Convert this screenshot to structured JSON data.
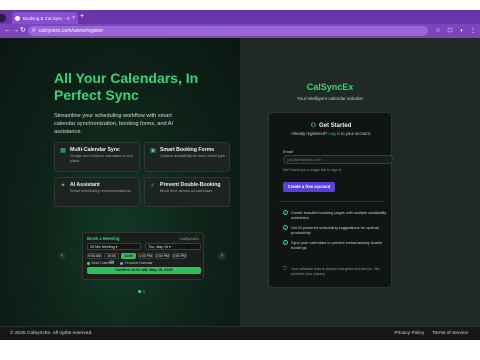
{
  "browser": {
    "tab_title": "Booking & Cal Sync - CalSyncEx",
    "tab_close": "×",
    "new_tab": "+",
    "url": "calsyncex.com/users/register",
    "back": "←",
    "forward": "→",
    "reload": "↻",
    "star": "☆",
    "extension": "⬡",
    "profile": "◐",
    "menu": "⋮"
  },
  "hero": {
    "title": "All Your Calendars, In Perfect Sync",
    "subtitle": "Streamline your scheduling workflow with smart calendar synchronization, booking forms, and AI assistance."
  },
  "features": [
    {
      "icon": "calendar-icon",
      "glyph": "▦",
      "title": "Multi-Calendar Sync",
      "desc": "Google and Outlook calendars in one place."
    },
    {
      "icon": "form-icon",
      "glyph": "▣",
      "title": "Smart Booking Forms",
      "desc": "Custom availability for each event type."
    },
    {
      "icon": "sparkle-icon",
      "glyph": "✦",
      "title": "AI Assistant",
      "desc": "Smart scheduling recommendations."
    },
    {
      "icon": "shield-check-icon",
      "glyph": "✓",
      "title": "Prevent Double-Booking",
      "desc": "Block time across all calendars."
    }
  ],
  "carousel": {
    "prev": "‹",
    "next": "›",
    "booking": {
      "title": "Book a Meeting",
      "brand": "CalSyncEx",
      "meeting_select": "30 Min Meeting",
      "date_select": "Thu, May 15",
      "slots": [
        "9:00 AM",
        "10:00 AM",
        "11:00 AM",
        "1:00 PM",
        "2:00 PM",
        "3:00 PM"
      ],
      "active_slot": "11:00 AM",
      "legend": [
        {
          "label": "Work Calendar",
          "color": "#37d47a"
        },
        {
          "label": "Personal Calendar",
          "color": "#8a93ff"
        }
      ],
      "confirm": "Confirm 11:00 AM, May 15, 2025"
    },
    "dot_count": 2,
    "active_dot": 0
  },
  "signup": {
    "brand": "CalSyncEx",
    "tagline": "Your intelligent calendar solution",
    "heading": "Get Started",
    "already": "Already registered?",
    "login_link": "Log in",
    "to_account": "to your account.",
    "email_label": "Email",
    "email_placeholder": "you@example.com",
    "email_hint": "We'll send you a magic link to sign in",
    "cta": "Create a free account",
    "benefits": [
      "Create beautiful booking pages with multiple availability schedules",
      "Get AI-powered scheduling suggestions for optimal productivity",
      "Sync your calendars to prevent embarrassing double bookings"
    ],
    "security_note": "Your calendar data is always encrypted and secure. We prioritize your privacy."
  },
  "footer": {
    "copyright": "© 2025 CalSyncEx. All rights reserved.",
    "privacy": "Privacy Policy",
    "terms": "Terms of Service"
  },
  "colors": {
    "accent": "#37d47a",
    "cta": "#5b3fd6",
    "browser": "#7c45c0"
  }
}
